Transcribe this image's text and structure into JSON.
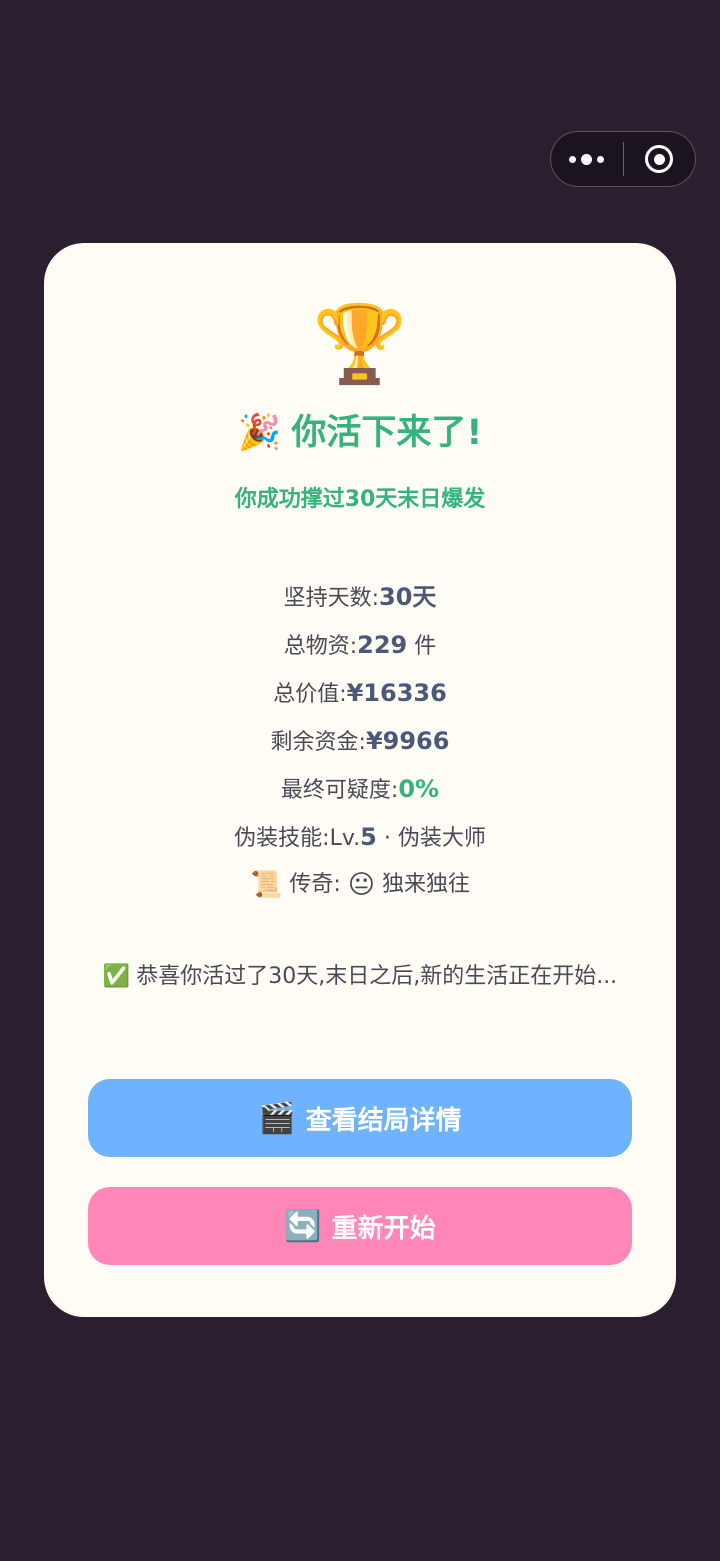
{
  "capsule": {
    "more_icon": "more-dots-icon",
    "close_icon": "target-circle-icon"
  },
  "result": {
    "trophy": "🏆",
    "title_emoji": "🎉",
    "title": "你活下来了!",
    "subtitle": "你成功撑过30天末日爆发"
  },
  "stats": {
    "days_label": "坚持天数:",
    "days_value": "30天",
    "supplies_label": "总物资:",
    "supplies_value": "229",
    "supplies_unit": " 件",
    "total_value_label": "总价值:",
    "total_value_value": "¥16336",
    "funds_label": "剩余资金:",
    "funds_value": "¥9966",
    "suspicion_label": "最终可疑度:",
    "suspicion_value": "0%",
    "skill_label": "伪装技能:",
    "skill_prefix": "Lv.",
    "skill_level": "5",
    "skill_suffix": " · 伪装大师",
    "legend_emoji": "📜",
    "legend_label": "传奇:",
    "legend_face": "😐",
    "legend_value": "独来独往"
  },
  "message": {
    "emoji": "✅",
    "text": "恭喜你活过了30天,末日之后,新的生活正在开始..."
  },
  "buttons": {
    "view_emoji": "🎬",
    "view_label": "查看结局详情",
    "restart_emoji": "🔄",
    "restart_label": "重新开始"
  },
  "colors": {
    "background": "#2b1e2e",
    "card": "#fffdf6",
    "accent_green": "#35b37c",
    "value_blue": "#4b5877",
    "button_blue": "#6fb3ff",
    "button_pink": "#ff86b6"
  }
}
